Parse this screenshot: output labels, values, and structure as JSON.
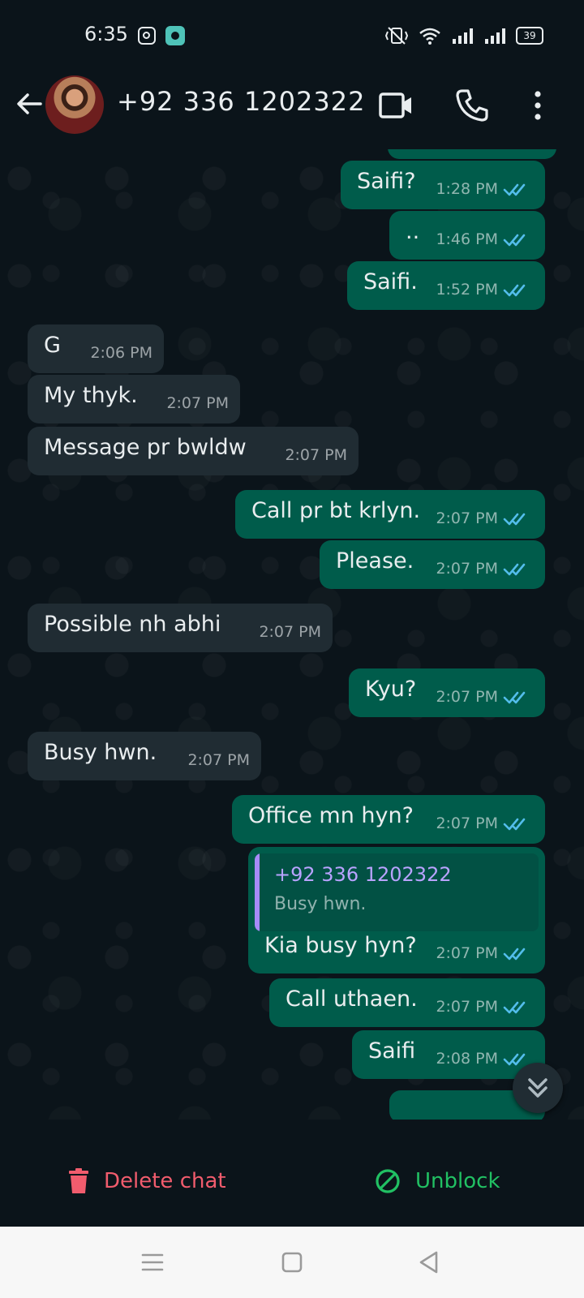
{
  "status_bar": {
    "time": "6:35",
    "battery": "39",
    "icons": [
      "instagram-icon",
      "app-notification-icon",
      "vibrate-icon",
      "wifi-icon",
      "signal-icon",
      "signal-icon",
      "battery-icon"
    ]
  },
  "header": {
    "contact_name": "+92 336 1202322",
    "icons": [
      "back-arrow-icon",
      "video-call-icon",
      "voice-call-icon",
      "more-options-icon"
    ]
  },
  "messages": [
    {
      "dir": "out",
      "text": "Saifi?",
      "time": "1:28 PM",
      "ticks": "read"
    },
    {
      "dir": "out",
      "text": "..",
      "time": "1:46 PM",
      "ticks": "read"
    },
    {
      "dir": "out",
      "text": "Saifi.",
      "time": "1:52 PM",
      "ticks": "read"
    },
    {
      "dir": "in",
      "text": "G",
      "time": "2:06 PM"
    },
    {
      "dir": "in",
      "text": "My thyk.",
      "time": "2:07 PM"
    },
    {
      "dir": "in",
      "text": "Message pr bwldw",
      "time": "2:07 PM"
    },
    {
      "dir": "out",
      "text": "Call pr bt krlyn.",
      "time": "2:07 PM",
      "ticks": "read"
    },
    {
      "dir": "out",
      "text": "Please.",
      "time": "2:07 PM",
      "ticks": "read"
    },
    {
      "dir": "in",
      "text": "Possible nh abhi",
      "time": "2:07 PM"
    },
    {
      "dir": "out",
      "text": "Kyu?",
      "time": "2:07 PM",
      "ticks": "read"
    },
    {
      "dir": "in",
      "text": "Busy hwn.",
      "time": "2:07 PM"
    },
    {
      "dir": "out",
      "text": "Office mn hyn?",
      "time": "2:07 PM",
      "ticks": "read"
    },
    {
      "dir": "out",
      "text": "Kia busy hyn?",
      "time": "2:07 PM",
      "ticks": "read",
      "quote": {
        "author": "+92 336 1202322",
        "text": "Busy hwn."
      }
    },
    {
      "dir": "out",
      "text": "Call uthaen.",
      "time": "2:07 PM",
      "ticks": "read"
    },
    {
      "dir": "out",
      "text": "Saifi",
      "time": "2:08 PM",
      "ticks": "read"
    }
  ],
  "blocked_bar": {
    "delete_label": "Delete chat",
    "unblock_label": "Unblock"
  },
  "colors": {
    "background": "#0b141a",
    "outgoing_bubble": "#005c4b",
    "incoming_bubble": "#202c33",
    "read_ticks": "#53bdeb",
    "delete": "#f15c6d",
    "unblock": "#21c063"
  }
}
